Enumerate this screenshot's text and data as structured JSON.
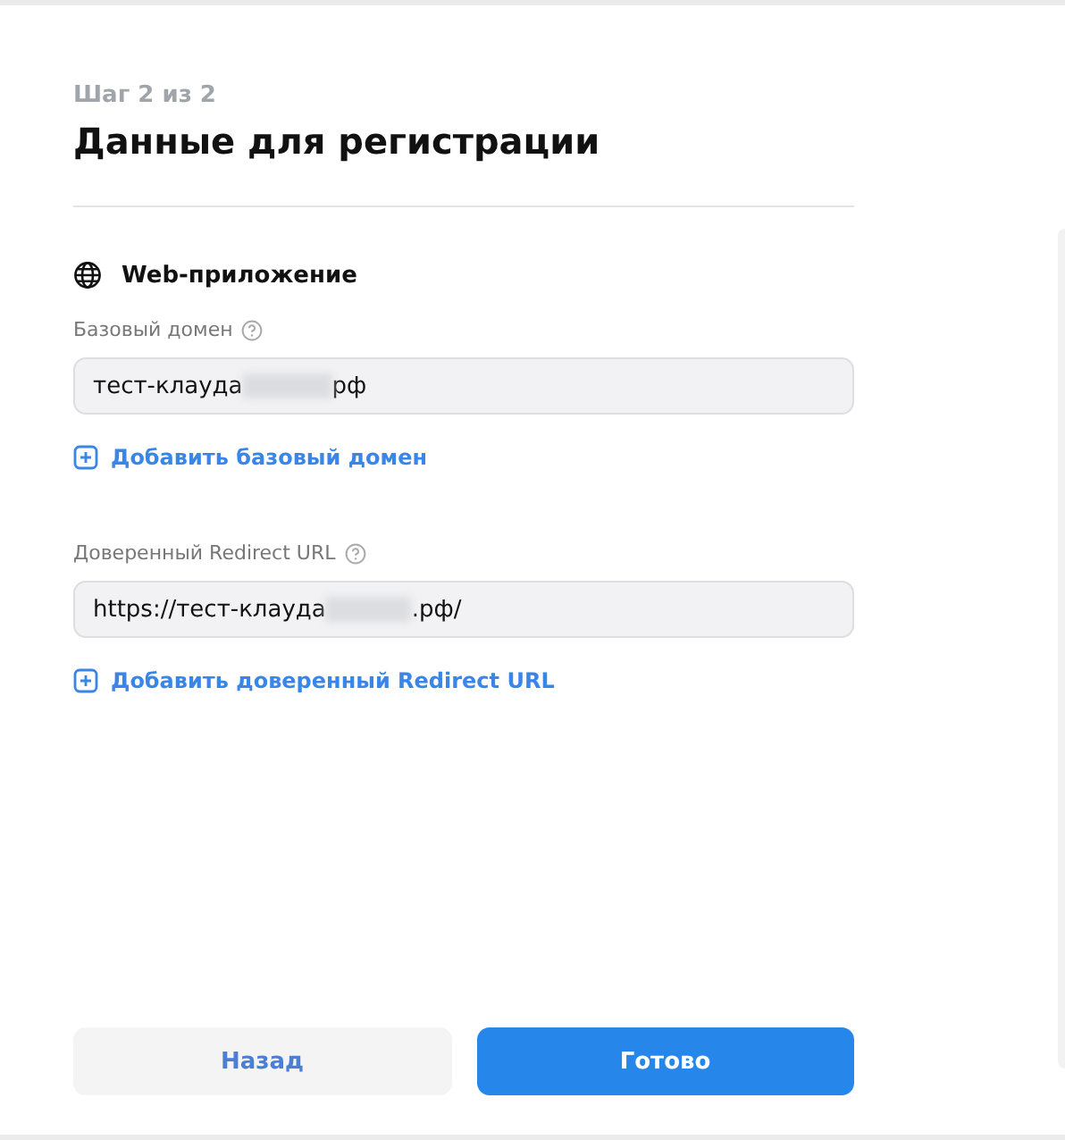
{
  "step": "Шаг 2 из 2",
  "title": "Данные для регистрации",
  "section": {
    "title": "Web-приложение"
  },
  "fields": [
    {
      "label": "Базовый домен",
      "value_start": "тест-клауда",
      "value_end": "рф",
      "redacted": true,
      "add_link": "Добавить базовый домен"
    },
    {
      "label": "Доверенный Redirect URL",
      "value_start": "https://тест-клауда",
      "value_end": ".рф/",
      "redacted": true,
      "add_link": "Добавить доверенный Redirect URL"
    }
  ],
  "buttons": [
    {
      "label": "Назад",
      "kind": "secondary"
    },
    {
      "label": "Готово",
      "kind": "primary"
    }
  ]
}
